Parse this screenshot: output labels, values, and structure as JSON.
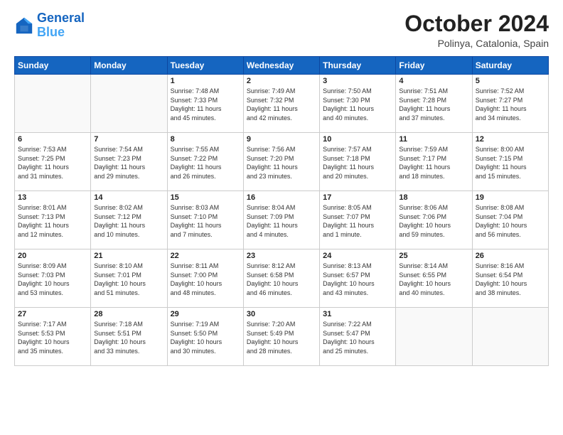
{
  "header": {
    "logo_line1": "General",
    "logo_line2": "Blue",
    "month": "October 2024",
    "location": "Polinya, Catalonia, Spain"
  },
  "weekdays": [
    "Sunday",
    "Monday",
    "Tuesday",
    "Wednesday",
    "Thursday",
    "Friday",
    "Saturday"
  ],
  "weeks": [
    [
      {
        "day": "",
        "info": ""
      },
      {
        "day": "",
        "info": ""
      },
      {
        "day": "1",
        "info": "Sunrise: 7:48 AM\nSunset: 7:33 PM\nDaylight: 11 hours\nand 45 minutes."
      },
      {
        "day": "2",
        "info": "Sunrise: 7:49 AM\nSunset: 7:32 PM\nDaylight: 11 hours\nand 42 minutes."
      },
      {
        "day": "3",
        "info": "Sunrise: 7:50 AM\nSunset: 7:30 PM\nDaylight: 11 hours\nand 40 minutes."
      },
      {
        "day": "4",
        "info": "Sunrise: 7:51 AM\nSunset: 7:28 PM\nDaylight: 11 hours\nand 37 minutes."
      },
      {
        "day": "5",
        "info": "Sunrise: 7:52 AM\nSunset: 7:27 PM\nDaylight: 11 hours\nand 34 minutes."
      }
    ],
    [
      {
        "day": "6",
        "info": "Sunrise: 7:53 AM\nSunset: 7:25 PM\nDaylight: 11 hours\nand 31 minutes."
      },
      {
        "day": "7",
        "info": "Sunrise: 7:54 AM\nSunset: 7:23 PM\nDaylight: 11 hours\nand 29 minutes."
      },
      {
        "day": "8",
        "info": "Sunrise: 7:55 AM\nSunset: 7:22 PM\nDaylight: 11 hours\nand 26 minutes."
      },
      {
        "day": "9",
        "info": "Sunrise: 7:56 AM\nSunset: 7:20 PM\nDaylight: 11 hours\nand 23 minutes."
      },
      {
        "day": "10",
        "info": "Sunrise: 7:57 AM\nSunset: 7:18 PM\nDaylight: 11 hours\nand 20 minutes."
      },
      {
        "day": "11",
        "info": "Sunrise: 7:59 AM\nSunset: 7:17 PM\nDaylight: 11 hours\nand 18 minutes."
      },
      {
        "day": "12",
        "info": "Sunrise: 8:00 AM\nSunset: 7:15 PM\nDaylight: 11 hours\nand 15 minutes."
      }
    ],
    [
      {
        "day": "13",
        "info": "Sunrise: 8:01 AM\nSunset: 7:13 PM\nDaylight: 11 hours\nand 12 minutes."
      },
      {
        "day": "14",
        "info": "Sunrise: 8:02 AM\nSunset: 7:12 PM\nDaylight: 11 hours\nand 10 minutes."
      },
      {
        "day": "15",
        "info": "Sunrise: 8:03 AM\nSunset: 7:10 PM\nDaylight: 11 hours\nand 7 minutes."
      },
      {
        "day": "16",
        "info": "Sunrise: 8:04 AM\nSunset: 7:09 PM\nDaylight: 11 hours\nand 4 minutes."
      },
      {
        "day": "17",
        "info": "Sunrise: 8:05 AM\nSunset: 7:07 PM\nDaylight: 11 hours\nand 1 minute."
      },
      {
        "day": "18",
        "info": "Sunrise: 8:06 AM\nSunset: 7:06 PM\nDaylight: 10 hours\nand 59 minutes."
      },
      {
        "day": "19",
        "info": "Sunrise: 8:08 AM\nSunset: 7:04 PM\nDaylight: 10 hours\nand 56 minutes."
      }
    ],
    [
      {
        "day": "20",
        "info": "Sunrise: 8:09 AM\nSunset: 7:03 PM\nDaylight: 10 hours\nand 53 minutes."
      },
      {
        "day": "21",
        "info": "Sunrise: 8:10 AM\nSunset: 7:01 PM\nDaylight: 10 hours\nand 51 minutes."
      },
      {
        "day": "22",
        "info": "Sunrise: 8:11 AM\nSunset: 7:00 PM\nDaylight: 10 hours\nand 48 minutes."
      },
      {
        "day": "23",
        "info": "Sunrise: 8:12 AM\nSunset: 6:58 PM\nDaylight: 10 hours\nand 46 minutes."
      },
      {
        "day": "24",
        "info": "Sunrise: 8:13 AM\nSunset: 6:57 PM\nDaylight: 10 hours\nand 43 minutes."
      },
      {
        "day": "25",
        "info": "Sunrise: 8:14 AM\nSunset: 6:55 PM\nDaylight: 10 hours\nand 40 minutes."
      },
      {
        "day": "26",
        "info": "Sunrise: 8:16 AM\nSunset: 6:54 PM\nDaylight: 10 hours\nand 38 minutes."
      }
    ],
    [
      {
        "day": "27",
        "info": "Sunrise: 7:17 AM\nSunset: 5:53 PM\nDaylight: 10 hours\nand 35 minutes."
      },
      {
        "day": "28",
        "info": "Sunrise: 7:18 AM\nSunset: 5:51 PM\nDaylight: 10 hours\nand 33 minutes."
      },
      {
        "day": "29",
        "info": "Sunrise: 7:19 AM\nSunset: 5:50 PM\nDaylight: 10 hours\nand 30 minutes."
      },
      {
        "day": "30",
        "info": "Sunrise: 7:20 AM\nSunset: 5:49 PM\nDaylight: 10 hours\nand 28 minutes."
      },
      {
        "day": "31",
        "info": "Sunrise: 7:22 AM\nSunset: 5:47 PM\nDaylight: 10 hours\nand 25 minutes."
      },
      {
        "day": "",
        "info": ""
      },
      {
        "day": "",
        "info": ""
      }
    ]
  ]
}
